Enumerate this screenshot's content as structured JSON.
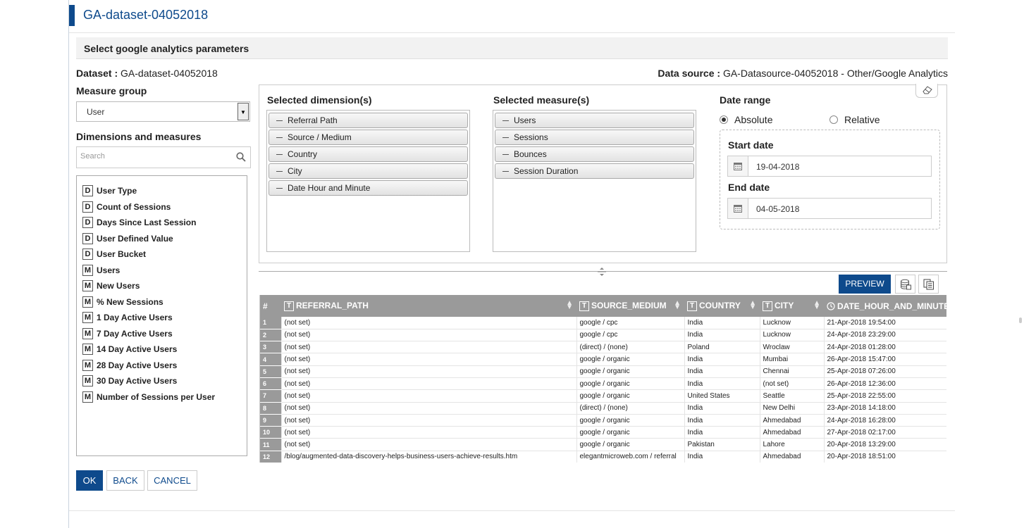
{
  "page": {
    "title": "GA-dataset-04052018"
  },
  "section": {
    "heading": "Select google analytics parameters"
  },
  "info": {
    "dataset_label": "Dataset :",
    "dataset_value": "GA-dataset-04052018",
    "datasource_label": "Data source :",
    "datasource_value": "GA-Datasource-04052018 - Other/Google Analytics"
  },
  "measure_group": {
    "label": "Measure group",
    "selected": "User"
  },
  "dimensions_measures": {
    "label": "Dimensions and measures",
    "search_placeholder": "Search",
    "items": [
      {
        "type": "D",
        "label": "User Type"
      },
      {
        "type": "D",
        "label": "Count of Sessions"
      },
      {
        "type": "D",
        "label": "Days Since Last Session"
      },
      {
        "type": "D",
        "label": "User Defined Value"
      },
      {
        "type": "D",
        "label": "User Bucket"
      },
      {
        "type": "M",
        "label": "Users"
      },
      {
        "type": "M",
        "label": "New Users"
      },
      {
        "type": "M",
        "label": "% New Sessions"
      },
      {
        "type": "M",
        "label": "1 Day Active Users"
      },
      {
        "type": "M",
        "label": "7 Day Active Users"
      },
      {
        "type": "M",
        "label": "14 Day Active Users"
      },
      {
        "type": "M",
        "label": "28 Day Active Users"
      },
      {
        "type": "M",
        "label": "30 Day Active Users"
      },
      {
        "type": "M",
        "label": "Number of Sessions per User"
      }
    ]
  },
  "selected_dimensions": {
    "label": "Selected dimension(s)",
    "items": [
      "Referral Path",
      "Source / Medium",
      "Country",
      "City",
      "Date Hour and Minute"
    ]
  },
  "selected_measures": {
    "label": "Selected measure(s)",
    "items": [
      "Users",
      "Sessions",
      "Bounces",
      "Session Duration"
    ]
  },
  "date_range": {
    "label": "Date range",
    "absolute_label": "Absolute",
    "relative_label": "Relative",
    "selected": "Absolute",
    "start_label": "Start date",
    "start_value": "19-04-2018",
    "end_label": "End date",
    "end_value": "04-05-2018"
  },
  "toolbar": {
    "preview_label": "PREVIEW"
  },
  "grid": {
    "columns": [
      {
        "type": "#",
        "label": "#"
      },
      {
        "type": "T",
        "label": "REFERRAL_PATH"
      },
      {
        "type": "T",
        "label": "SOURCE_MEDIUM"
      },
      {
        "type": "T",
        "label": "COUNTRY"
      },
      {
        "type": "T",
        "label": "CITY"
      },
      {
        "type": "clock",
        "label": "DATE_HOUR_AND_MINUTE"
      }
    ],
    "rows": [
      [
        "1",
        "(not set)",
        "google / cpc",
        "India",
        "Lucknow",
        "21-Apr-2018 19:54:00"
      ],
      [
        "2",
        "(not set)",
        "google / cpc",
        "India",
        "Lucknow",
        "24-Apr-2018 23:29:00"
      ],
      [
        "3",
        "(not set)",
        "(direct) / (none)",
        "Poland",
        "Wroclaw",
        "24-Apr-2018 01:28:00"
      ],
      [
        "4",
        "(not set)",
        "google / organic",
        "India",
        "Mumbai",
        "26-Apr-2018 15:47:00"
      ],
      [
        "5",
        "(not set)",
        "google / organic",
        "India",
        "Chennai",
        "25-Apr-2018 07:26:00"
      ],
      [
        "6",
        "(not set)",
        "google / organic",
        "India",
        "(not set)",
        "26-Apr-2018 12:36:00"
      ],
      [
        "7",
        "(not set)",
        "google / organic",
        "United States",
        "Seattle",
        "25-Apr-2018 22:55:00"
      ],
      [
        "8",
        "(not set)",
        "(direct) / (none)",
        "India",
        "New Delhi",
        "23-Apr-2018 14:18:00"
      ],
      [
        "9",
        "(not set)",
        "google / organic",
        "India",
        "Ahmedabad",
        "24-Apr-2018 16:28:00"
      ],
      [
        "10",
        "(not set)",
        "google / organic",
        "India",
        "Ahmedabad",
        "27-Apr-2018 02:17:00"
      ],
      [
        "11",
        "(not set)",
        "google / organic",
        "Pakistan",
        "Lahore",
        "20-Apr-2018 13:29:00"
      ],
      [
        "12",
        "/blog/augmented-data-discovery-helps-business-users-achieve-results.htm",
        "elegantmicroweb.com / referral",
        "India",
        "Ahmedabad",
        "20-Apr-2018 18:51:00"
      ]
    ]
  },
  "buttons": {
    "ok": "OK",
    "back": "BACK",
    "cancel": "CANCEL"
  },
  "colors": {
    "brand": "#0e4a8c",
    "grid_header": "#9a9a9a"
  }
}
